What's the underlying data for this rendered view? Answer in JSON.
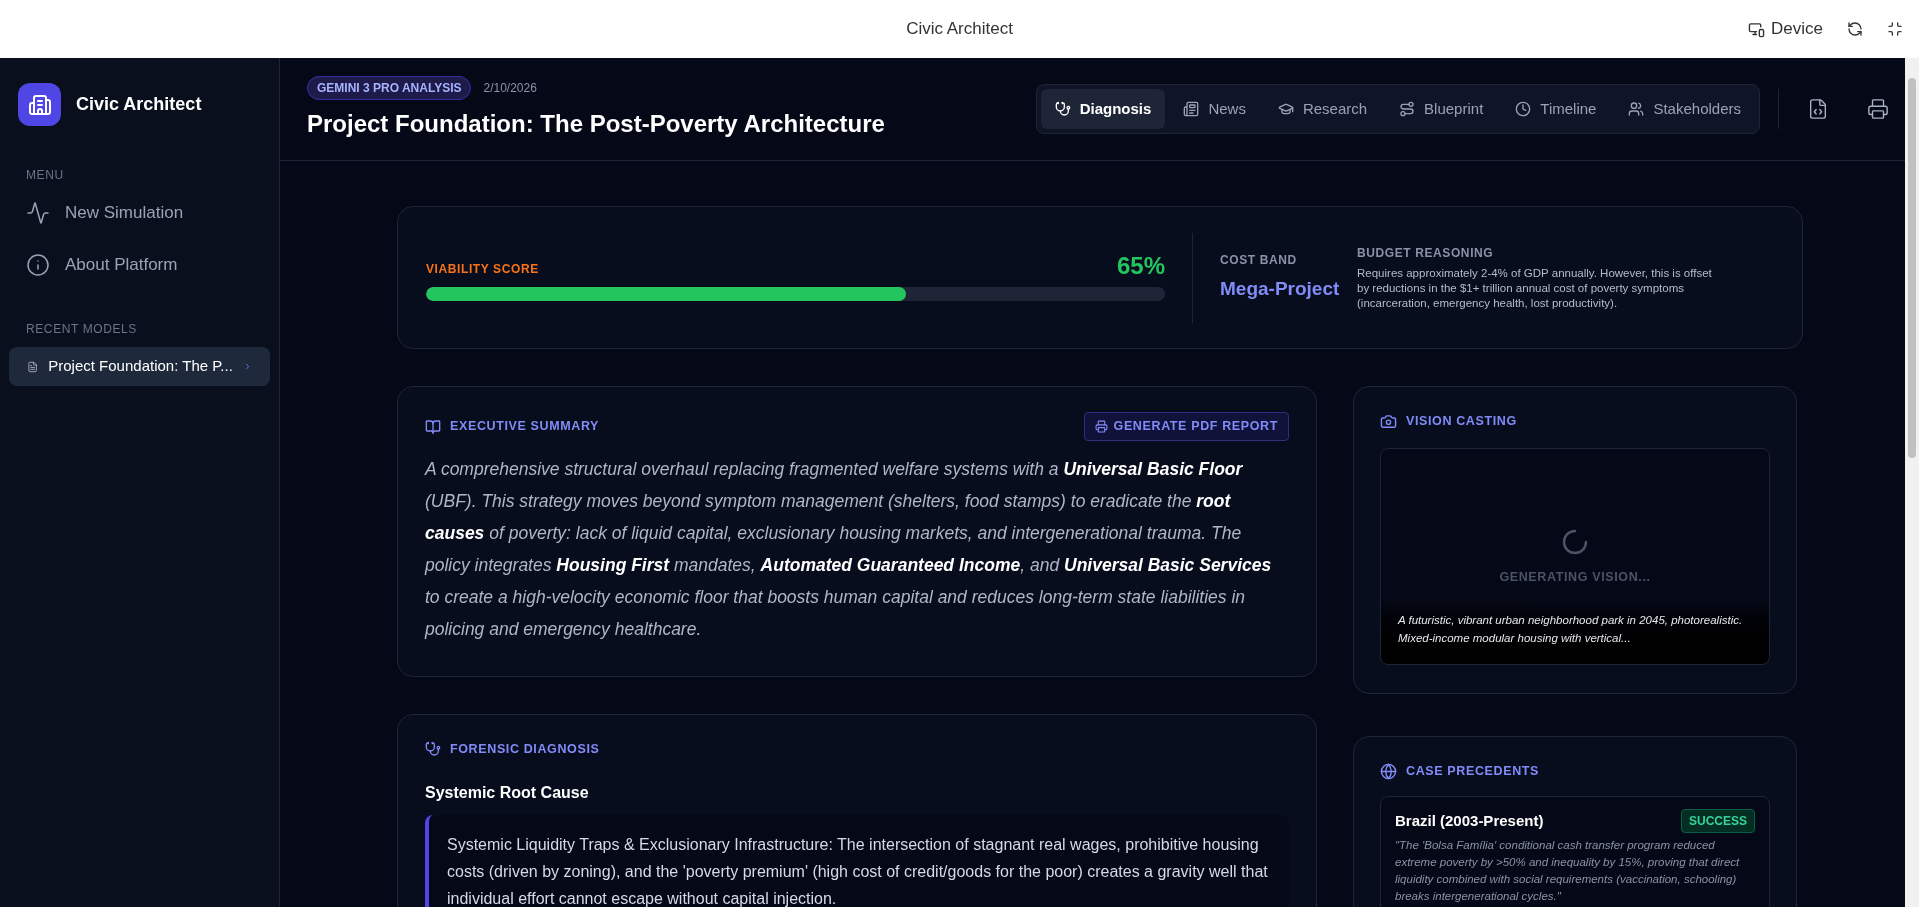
{
  "browser_bar": {
    "title": "Civic Architect",
    "device_label": "Device"
  },
  "sidebar": {
    "app_name": "Civic Architect",
    "menu_heading": "MENU",
    "menu_items": [
      {
        "kind": "activity",
        "label": "New Simulation"
      },
      {
        "kind": "info",
        "label": "About Platform"
      }
    ],
    "recent_heading": "RECENT MODELS",
    "recent_items": [
      {
        "label": "Project Foundation: The P...",
        "selected": true
      }
    ]
  },
  "header": {
    "badge": "GEMINI 3 PRO ANALYSIS",
    "date": "2/10/2026",
    "title": "Project Foundation: The Post-Poverty Architecture",
    "tabs": [
      {
        "kind": "stethoscope",
        "label": "Diagnosis",
        "selected": true
      },
      {
        "kind": "news",
        "label": "News",
        "selected": false
      },
      {
        "kind": "cap",
        "label": "Research",
        "selected": false
      },
      {
        "kind": "route",
        "label": "Blueprint",
        "selected": false
      },
      {
        "kind": "clock",
        "label": "Timeline",
        "selected": false
      },
      {
        "kind": "users",
        "label": "Stakeholders",
        "selected": false
      }
    ]
  },
  "viability": {
    "label": "VIABILITY SCORE",
    "score": "65%",
    "level": 0.65,
    "cost_band_label": "COST BAND",
    "cost_band": "Mega-Project",
    "budget_heading": "BUDGET REASONING",
    "budget_text": "Requires approximately 2-4% of GDP annually. However, this is offset by reductions in the $1+ trillion annual cost of poverty symptoms (incarceration, emergency health, lost productivity)."
  },
  "executive_summary": {
    "heading": "EXECUTIVE SUMMARY",
    "button": "GENERATE PDF REPORT",
    "text": "A comprehensive structural overhaul replacing fragmented welfare systems with a **Universal Basic Floor** (UBF). This strategy moves beyond symptom management (shelters, food stamps) to eradicate the **root causes** of poverty: lack of liquid capital, exclusionary housing markets, and intergenerational trauma. The policy integrates **Housing First** mandates, **Automated Guaranteed Income**, and **Universal Basic Services** to create a high-velocity economic floor that boosts human capital and reduces long-term state liabilities in policing and emergency healthcare."
  },
  "forensic_diagnosis": {
    "heading": "FORENSIC DIAGNOSIS",
    "subheading": "Systemic Root Cause",
    "text": "Systemic Liquidity Traps & Exclusionary Infrastructure: The intersection of stagnant real wages, prohibitive housing costs (driven by zoning), and the 'poverty premium' (high cost of credit/goods for the poor) creates a gravity well that individual effort cannot escape without capital injection."
  },
  "vision_casting": {
    "heading": "VISION CASTING",
    "status": "GENERATING VISION...",
    "caption": "A futuristic, vibrant urban neighborhood park in 2045, photorealistic. Mixed-income modular housing with vertical..."
  },
  "case_precedents": {
    "heading": "CASE PRECEDENTS",
    "items": [
      {
        "title": "Brazil (2003-Present)",
        "status": "SUCCESS",
        "kind": "success",
        "text": "\"The 'Bolsa Família' conditional cash transfer program reduced extreme poverty by >50% and inequality by 15%, proving that direct liquidity combined with social requirements (vaccination, schooling) breaks intergenerational cycles.\""
      }
    ]
  }
}
